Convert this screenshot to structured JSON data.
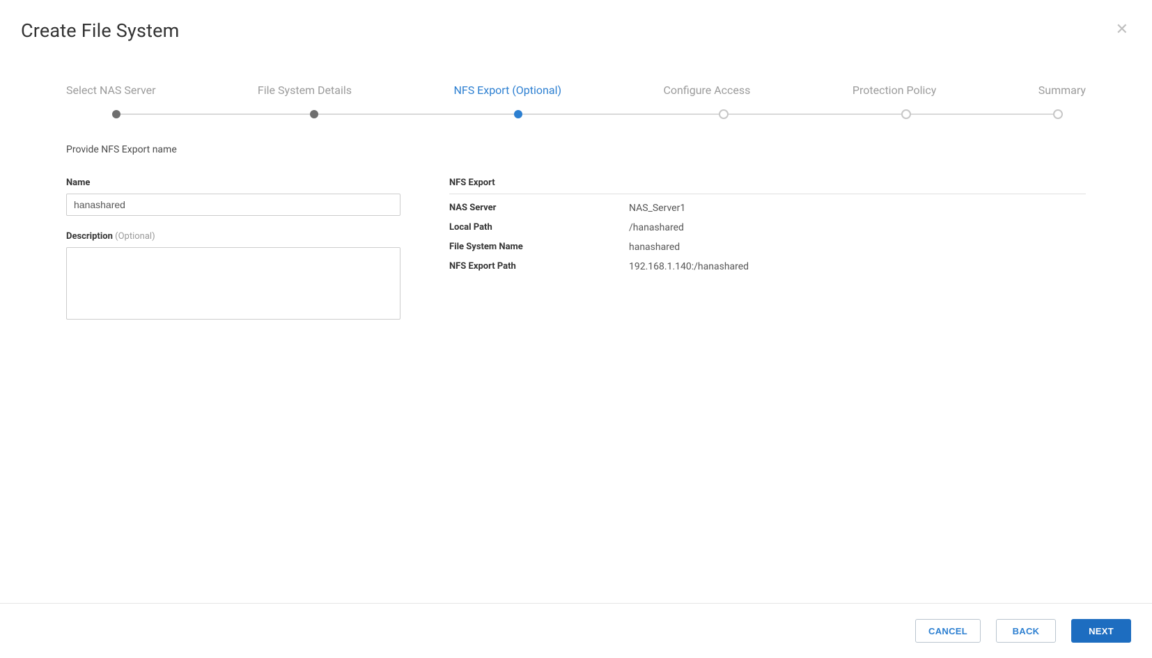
{
  "header": {
    "title": "Create File System"
  },
  "stepper": {
    "steps": [
      {
        "label": "Select NAS Server",
        "state": "done"
      },
      {
        "label": "File System Details",
        "state": "done"
      },
      {
        "label": "NFS Export (Optional)",
        "state": "current"
      },
      {
        "label": "Configure Access",
        "state": "pending"
      },
      {
        "label": "Protection Policy",
        "state": "pending"
      },
      {
        "label": "Summary",
        "state": "pending"
      }
    ]
  },
  "form": {
    "instruction": "Provide NFS Export name",
    "name_label": "Name",
    "name_value": "hanashared",
    "desc_label": "Description",
    "desc_optional": "(Optional)",
    "desc_value": ""
  },
  "summary": {
    "title": "NFS Export",
    "rows": [
      {
        "key": "NAS Server",
        "val": "NAS_Server1"
      },
      {
        "key": "Local Path",
        "val": "/hanashared"
      },
      {
        "key": "File System Name",
        "val": "hanashared"
      },
      {
        "key": "NFS Export Path",
        "val": "192.168.1.140:/hanashared"
      }
    ]
  },
  "footer": {
    "cancel": "CANCEL",
    "back": "BACK",
    "next": "NEXT"
  }
}
